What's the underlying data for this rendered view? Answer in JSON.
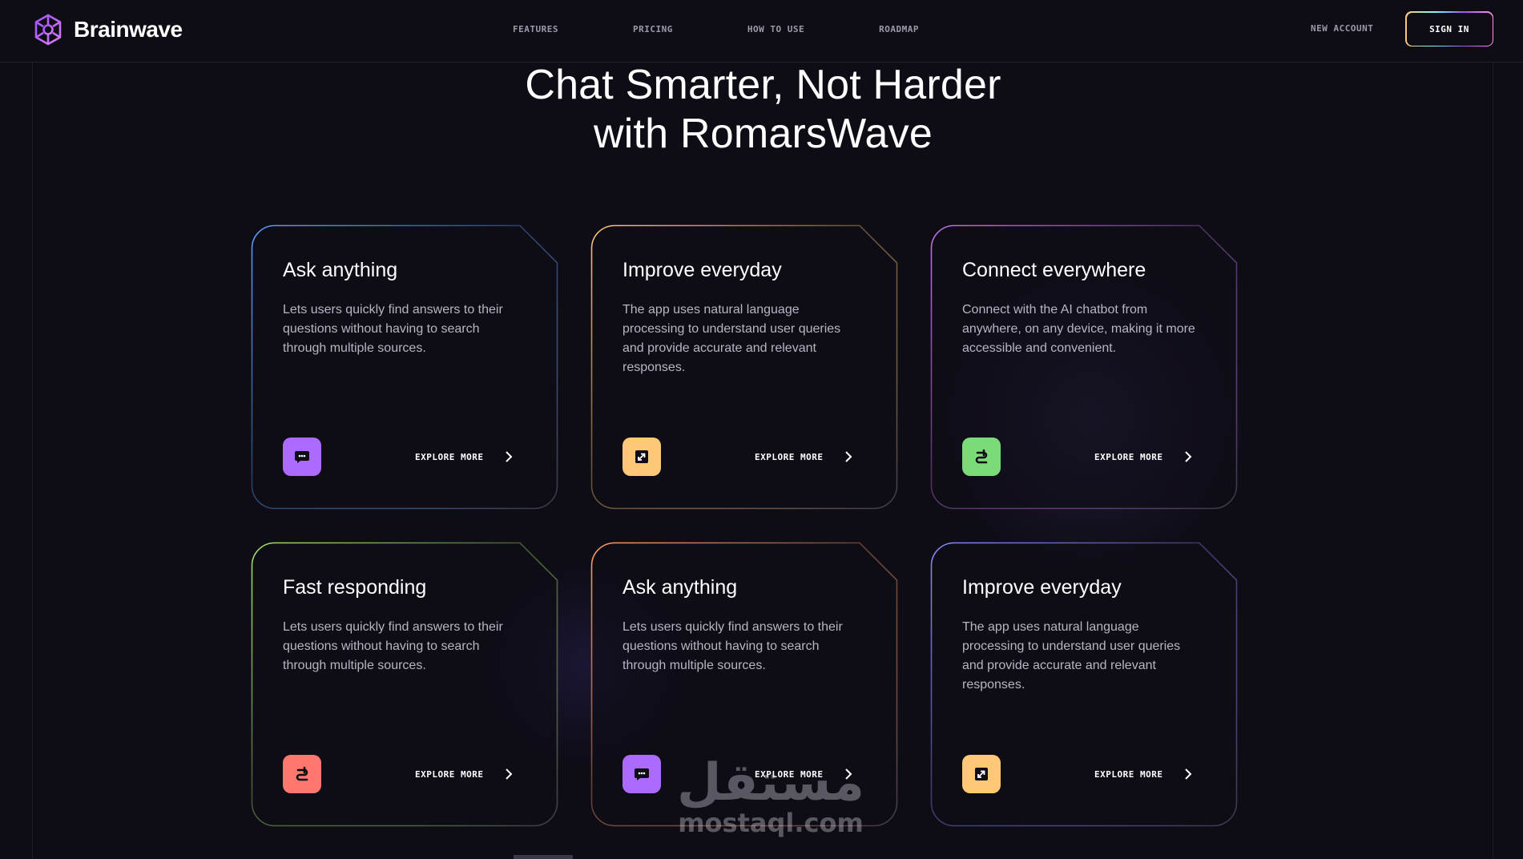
{
  "nav": {
    "brand": "Brainwave",
    "links": [
      "FEATURES",
      "PRICING",
      "HOW TO USE",
      "ROADMAP"
    ],
    "new_account": "NEW ACCOUNT",
    "sign_in": "SIGN IN"
  },
  "hero": {
    "line1": "Chat Smarter, Not Harder",
    "line2": "with RomarsWave"
  },
  "cards": [
    {
      "title": "Ask anything",
      "text": "Lets users quickly find answers to their questions without having to search through multiple sources.",
      "icon": "chat-icon",
      "icon_color": "#ac6aff",
      "border_color": "#5ba1ff",
      "explore": "EXPLORE MORE"
    },
    {
      "title": "Improve everyday",
      "text": "The app uses natural language processing to understand user queries and provide accurate and relevant responses.",
      "icon": "expand-icon",
      "icon_color": "#ffc876",
      "border_color": "#ffc876",
      "explore": "EXPLORE MORE"
    },
    {
      "title": "Connect everywhere",
      "text": "Connect with the AI chatbot from anywhere, on any device, making it more accessible and convenient.",
      "icon": "connect-icon",
      "icon_color": "#7adb78",
      "border_color": "#c471ed",
      "explore": "EXPLORE MORE"
    },
    {
      "title": "Fast responding",
      "text": "Lets users quickly find answers to their questions without having to search through multiple sources.",
      "icon": "connect-icon",
      "icon_color": "#ff776f",
      "border_color": "#a5e36e",
      "explore": "EXPLORE MORE"
    },
    {
      "title": "Ask anything",
      "text": "Lets users quickly find answers to their questions without having to search through multiple sources.",
      "icon": "chat-icon",
      "icon_color": "#ac6aff",
      "border_color": "#ff9f6e",
      "explore": "EXPLORE MORE"
    },
    {
      "title": "Improve everyday",
      "text": "The app uses natural language processing to understand user queries and provide accurate and relevant responses.",
      "icon": "expand-icon",
      "icon_color": "#ffc876",
      "border_color": "#8b8bff",
      "explore": "EXPLORE MORE"
    }
  ],
  "watermark": {
    "arabic": "مستقل",
    "latin": "mostaql.com"
  }
}
